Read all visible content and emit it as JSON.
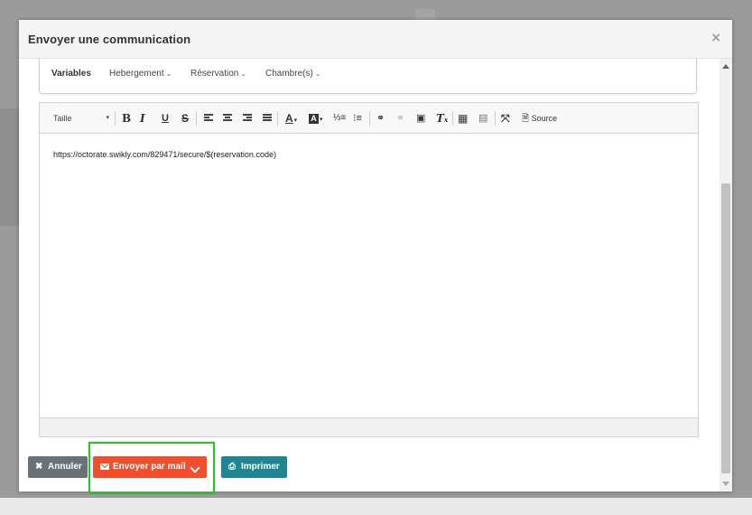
{
  "modal": {
    "title": "Envoyer une communication",
    "close_glyph": "×"
  },
  "variables": {
    "label": "Variables",
    "menus": [
      "Hebergement",
      "Réservation",
      "Chambre(s)"
    ]
  },
  "toolbar": {
    "size_label": "Taille",
    "source_label": "Source",
    "icons": [
      "bold-icon",
      "italic-icon",
      "underline-icon",
      "strike-icon",
      "align-left-icon",
      "align-center-icon",
      "align-right-icon",
      "justify-icon",
      "font-color-icon",
      "background-color-icon",
      "numbered-list-icon",
      "bulleted-list-icon",
      "link-icon",
      "unlink-icon",
      "image-icon",
      "clear-format-icon",
      "table-icon",
      "horizontal-rule-icon",
      "maximize-icon",
      "source-icon"
    ]
  },
  "editor": {
    "content": "https://octorate.swikly.com/829471/secure/$(reservation.code)"
  },
  "buttons": {
    "cancel": "Annuler",
    "mail": "Envoyer par mail",
    "print": "Imprimer"
  },
  "colors": {
    "cancel": "#6a7177",
    "mail": "#f24e2e",
    "print": "#1f8691",
    "highlight": "#22c622"
  }
}
